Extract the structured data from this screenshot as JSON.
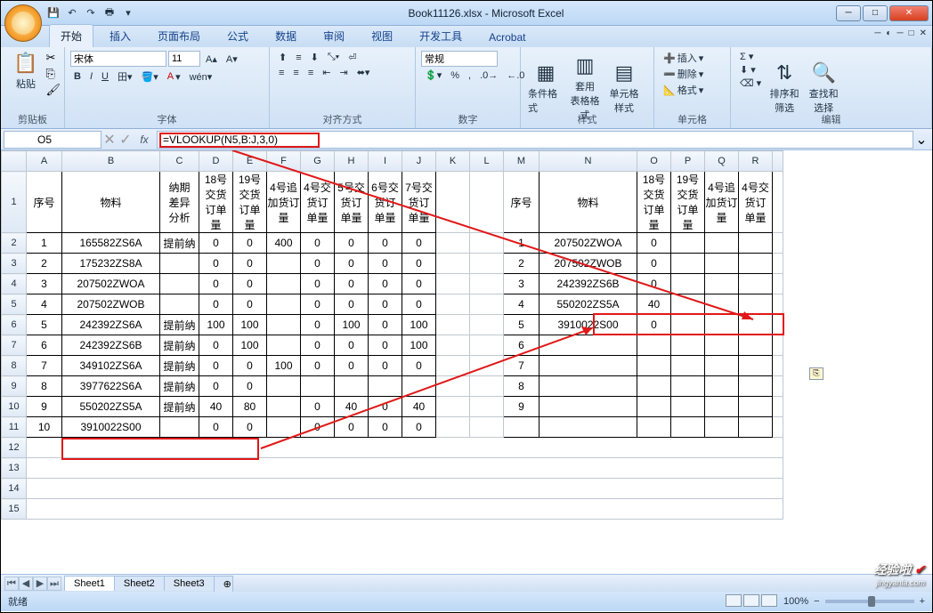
{
  "window": {
    "title": "Book11126.xlsx - Microsoft Excel"
  },
  "tabs": {
    "t0": "开始",
    "t1": "插入",
    "t2": "页面布局",
    "t3": "公式",
    "t4": "数据",
    "t5": "审阅",
    "t6": "视图",
    "t7": "开发工具",
    "t8": "Acrobat"
  },
  "ribbon": {
    "clipboard": {
      "paste": "粘贴",
      "label": "剪贴板"
    },
    "font": {
      "name": "宋体",
      "size": "11",
      "label": "字体"
    },
    "align": {
      "label": "对齐方式"
    },
    "number": {
      "fmt": "常规",
      "label": "数字"
    },
    "styles": {
      "b1": "条件格式",
      "b2": "套用\n表格格式",
      "b3": "单元格\n样式",
      "label": "样式"
    },
    "cells": {
      "ins": "插入",
      "del": "删除",
      "fmt": "格式",
      "label": "单元格"
    },
    "edit": {
      "sort": "排序和\n筛选",
      "find": "查找和\n选择",
      "label": "编辑"
    }
  },
  "namebox": "O5",
  "formula": "=VLOOKUP(N5,B:J,3,0)",
  "colhdr": {
    "A": "A",
    "B": "B",
    "C": "C",
    "D": "D",
    "E": "E",
    "F": "F",
    "G": "G",
    "H": "H",
    "I": "I",
    "J": "J",
    "K": "K",
    "L": "L",
    "M": "M",
    "N": "N",
    "O": "O",
    "P": "P",
    "Q": "Q",
    "R": "R"
  },
  "hdr": {
    "seq": "序号",
    "mat": "物料",
    "diff": "纳期\n差异\n分析",
    "d18": "18号\n交货\n订单\n量",
    "d19": "19号\n交货\n订单\n量",
    "a4": "4号追\n加货订\n量",
    "h4": "4号交\n货订\n单量",
    "h5": "5号交\n货订\n单量",
    "h6": "6号交\n货订\n单量",
    "h7": "7号交\n货订\n单量"
  },
  "rows": [
    {
      "n": "1",
      "a": "1",
      "b": "165582ZS6A",
      "c": "提前纳",
      "d": "0",
      "e": "0",
      "f": "400",
      "g": "0",
      "h": "0",
      "i": "0",
      "j": "0",
      "m": "1",
      "mn": "207502ZWOA",
      "o": "0"
    },
    {
      "n": "2",
      "a": "2",
      "b": "175232ZS8A",
      "c": "",
      "d": "0",
      "e": "0",
      "f": "",
      "g": "0",
      "h": "0",
      "i": "0",
      "j": "0",
      "m": "2",
      "mn": "207502ZWOB",
      "o": "0"
    },
    {
      "n": "3",
      "a": "3",
      "b": "207502ZWOA",
      "c": "",
      "d": "0",
      "e": "0",
      "f": "",
      "g": "0",
      "h": "0",
      "i": "0",
      "j": "0",
      "m": "3",
      "mn": "242392ZS6B",
      "o": "0"
    },
    {
      "n": "4",
      "a": "4",
      "b": "207502ZWOB",
      "c": "",
      "d": "0",
      "e": "0",
      "f": "",
      "g": "0",
      "h": "0",
      "i": "0",
      "j": "0",
      "m": "4",
      "mn": "550202ZS5A",
      "o": "40"
    },
    {
      "n": "5",
      "a": "5",
      "b": "242392ZS6A",
      "c": "提前纳",
      "d": "100",
      "e": "100",
      "f": "",
      "g": "0",
      "h": "100",
      "i": "0",
      "j": "100",
      "m": "5",
      "mn": "3910022S00",
      "o": "0"
    },
    {
      "n": "6",
      "a": "6",
      "b": "242392ZS6B",
      "c": "提前纳",
      "d": "0",
      "e": "100",
      "f": "",
      "g": "0",
      "h": "0",
      "i": "0",
      "j": "100",
      "m": "6",
      "mn": "",
      "o": ""
    },
    {
      "n": "7",
      "a": "7",
      "b": "349102ZS6A",
      "c": "提前纳",
      "d": "0",
      "e": "0",
      "f": "100",
      "g": "0",
      "h": "0",
      "i": "0",
      "j": "0",
      "m": "7",
      "mn": "",
      "o": ""
    },
    {
      "n": "8",
      "a": "8",
      "b": "3977622S6A",
      "c": "提前纳",
      "d": "0",
      "e": "0",
      "f": "",
      "g": "",
      "h": "",
      "i": "",
      "j": "",
      "m": "8",
      "mn": "",
      "o": ""
    },
    {
      "n": "9",
      "a": "9",
      "b": "550202ZS5A",
      "c": "提前纳",
      "d": "40",
      "e": "80",
      "f": "",
      "g": "0",
      "h": "40",
      "i": "0",
      "j": "40",
      "m": "9",
      "mn": "",
      "o": ""
    },
    {
      "n": "10",
      "a": "10",
      "b": "3910022S00",
      "c": "",
      "d": "0",
      "e": "0",
      "f": "",
      "g": "0",
      "h": "0",
      "i": "0",
      "j": "0",
      "m": "",
      "mn": "",
      "o": ""
    }
  ],
  "rownums": {
    "r11": "11",
    "r12": "12",
    "r13": "13",
    "r14": "14",
    "r15": "15"
  },
  "sheets": {
    "s1": "Sheet1",
    "s2": "Sheet2",
    "s3": "Sheet3"
  },
  "status": {
    "ready": "就绪",
    "zoom": "100%",
    "sep": " "
  },
  "wm": {
    "txt": "经验啦",
    "url": "jingyanla.com"
  }
}
